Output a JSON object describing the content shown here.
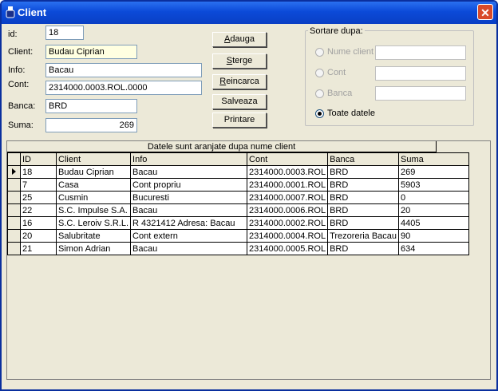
{
  "window": {
    "title": "Client",
    "close_glyph": "✕",
    "icon": "app-icon"
  },
  "form": {
    "id": {
      "label": "id:",
      "value": "18"
    },
    "client": {
      "label": "Client:",
      "value": "Budau Ciprian"
    },
    "info": {
      "label": "Info:",
      "value": "Bacau"
    },
    "cont": {
      "label": "Cont:",
      "value": "2314000.0003.ROL.0000"
    },
    "banca": {
      "label": "Banca:",
      "value": "BRD"
    },
    "suma": {
      "label": "Suma:",
      "value": "269"
    }
  },
  "buttons": {
    "adauga": {
      "hotkey": "A",
      "rest": "dauga"
    },
    "sterge": {
      "hotkey": "S",
      "rest": "terge"
    },
    "reincarca": {
      "hotkey": "R",
      "rest": "eincarca"
    },
    "salveaza": {
      "label": "Salveaza"
    },
    "printare": {
      "label": "Printare"
    }
  },
  "sort": {
    "title": "Sortare dupa:",
    "options": [
      {
        "label": "Nume client",
        "checked": false,
        "enabled": false,
        "input": ""
      },
      {
        "label": "Cont",
        "checked": false,
        "enabled": false,
        "input": ""
      },
      {
        "label": "Banca",
        "checked": false,
        "enabled": false,
        "input": ""
      },
      {
        "label": "Toate datele",
        "checked": true,
        "enabled": true
      }
    ]
  },
  "grid": {
    "caption": "Datele sunt aranjate dupa nume client",
    "columns": [
      "ID",
      "Client",
      "Info",
      "Cont",
      "Banca",
      "Suma"
    ],
    "selected_row": 0,
    "rows": [
      [
        "18",
        "Budau Ciprian",
        "Bacau",
        "2314000.0003.ROL",
        "BRD",
        "269"
      ],
      [
        "7",
        "Casa",
        "Cont propriu",
        "2314000.0001.ROL",
        "BRD",
        "5903"
      ],
      [
        "25",
        "Cusmin",
        "Bucuresti",
        "2314000.0007.ROL",
        "BRD",
        "0"
      ],
      [
        "22",
        "S.C. Impulse S.A.",
        "Bacau",
        "2314000.0006.ROL",
        "BRD",
        "20"
      ],
      [
        "16",
        "S.C. Leroiv S.R.L.",
        "R 4321412 Adresa: Bacau",
        "2314000.0002.ROL",
        "BRD",
        "4405"
      ],
      [
        "20",
        "Salubritate",
        "Cont extern",
        "2314000.0004.ROL",
        "Trezoreria Bacau",
        "90"
      ],
      [
        "21",
        "Simon Adrian",
        "Bacau",
        "2314000.0005.ROL",
        "BRD",
        "634"
      ]
    ]
  },
  "colors": {
    "title_bar": "#0b4ad8",
    "face": "#ece9d8",
    "close": "#d94a2a"
  }
}
